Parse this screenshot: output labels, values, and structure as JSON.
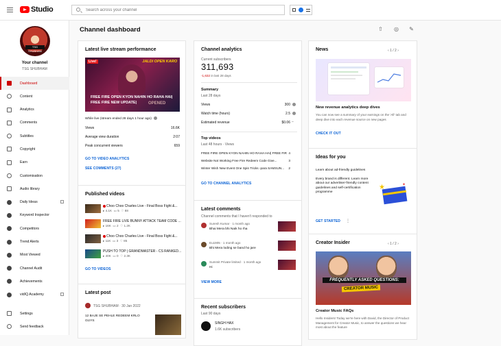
{
  "app": {
    "studio_label": "Studio",
    "search_placeholder": "Search across your channel"
  },
  "channel": {
    "label": "Your channel",
    "name": "TSG SHUBHAM",
    "avatar_text": "TSG SHUBHAM"
  },
  "nav": [
    {
      "label": "Dashboard",
      "icon": "dashboard-icon",
      "active": true
    },
    {
      "label": "Content",
      "icon": "content-icon"
    },
    {
      "label": "Analytics",
      "icon": "analytics-icon"
    },
    {
      "label": "Comments",
      "icon": "comments-icon"
    },
    {
      "label": "Subtitles",
      "icon": "subtitles-icon"
    },
    {
      "label": "Copyright",
      "icon": "copyright-icon"
    },
    {
      "label": "Earn",
      "icon": "earn-icon"
    },
    {
      "label": "Customisation",
      "icon": "customisation-icon"
    },
    {
      "label": "Audio library",
      "icon": "audio-library-icon"
    },
    {
      "label": "Daily Ideas",
      "icon": "daily-ideas-icon"
    },
    {
      "label": "Keyword Inspector",
      "icon": "keyword-inspector-icon"
    },
    {
      "label": "Competitors",
      "icon": "competitors-icon"
    },
    {
      "label": "Trend Alerts",
      "icon": "trend-alerts-icon"
    },
    {
      "label": "Most Viewed",
      "icon": "most-viewed-icon"
    },
    {
      "label": "Channel Audit",
      "icon": "channel-audit-icon"
    },
    {
      "label": "Achievements",
      "icon": "achievements-icon"
    },
    {
      "label": "vidIQ Academy",
      "icon": "vidiq-academy-icon"
    }
  ],
  "nav_bottom": [
    {
      "label": "Settings",
      "icon": "settings-icon"
    },
    {
      "label": "Send feedback",
      "icon": "feedback-icon"
    }
  ],
  "page": {
    "title": "Channel dashboard"
  },
  "live": {
    "title": "Latest live stream performance",
    "live_badge": "Live!",
    "thumb_top": "JALDI OPEN KARO",
    "thumb_text": "FREE FIRE OPEN KYON NAHIN HO RAHA HAI| FREE FIRE NEW UPDATE|",
    "thumb_overlay": "OPENED",
    "summary": "While live (stream ended 28 days 1 hour ago)",
    "stats": [
      {
        "label": "Views",
        "value": "16.6K"
      },
      {
        "label": "Average view duration",
        "value": "2:07"
      },
      {
        "label": "Peak concurrent viewers",
        "value": "659"
      }
    ],
    "link1": "GO TO VIDEO ANALYTICS",
    "link2": "SEE COMMENTS (27)"
  },
  "published": {
    "title": "Published videos",
    "items": [
      {
        "title": "Choo Choo Charles Live - Final Boss Fight &...",
        "views": "4.1K",
        "comments": "5",
        "likes": "88",
        "dot": true
      },
      {
        "title": "FREE FIRE LIVE BUNNY ATTACK TEAM CODE ...",
        "views": "16K",
        "comments": "2",
        "likes": "1.2K",
        "dot": false
      },
      {
        "title": "Choo Choo Charles Live - Final Boss Fight &...",
        "views": "11K",
        "comments": "3",
        "likes": "85",
        "dot": true
      },
      {
        "title": "PUSH TO TOP | GRANDMASTER - CS RANKED...",
        "views": "40K",
        "comments": "0",
        "likes": "2.3K",
        "dot": false
      }
    ],
    "link": "GO TO VIDEOS"
  },
  "latest_post": {
    "title": "Latest post",
    "author": "TSG SHUBHAM",
    "date": "30 Jan 2022",
    "text": "12 BAJE SE PEHLE REDEEM KRLO GUYS"
  },
  "analytics": {
    "title": "Channel analytics",
    "subs_label": "Current subscribers",
    "subs": "311,693",
    "change": "-1,632",
    "change_suffix": "in last 28 days",
    "summary_title": "Summary",
    "summary_range": "Last 28 days",
    "rows": [
      {
        "label": "Views",
        "value": "300"
      },
      {
        "label": "Watch time (hours)",
        "value": "2.5"
      },
      {
        "label": "Estimated revenue",
        "value": "$0.06"
      }
    ],
    "top_title": "Top videos",
    "top_range": "Last 48 hours · Views",
    "top_videos": [
      {
        "title": "FREE FIRE OPEN KYON NAHIN HO RAHA HAI| FREE FIR...",
        "value": "4"
      },
      {
        "title": "Website Not Working Free Fire Redeem Code Give...",
        "value": "3"
      },
      {
        "title": "Winter Wish New Event One Spin Tricks -para SAMSUN...",
        "value": "2"
      }
    ],
    "link": "GO TO CHANNEL ANALYTICS"
  },
  "comments": {
    "title": "Latest comments",
    "subtitle": "Channel comments that I haven't responded to",
    "items": [
      {
        "name": "Suresh Kumar · 1 month ago",
        "text": "Bhai Mera bhi Naik ho rha",
        "avatar": "#b03030"
      },
      {
        "name": "Eu1905 · 1 month ago",
        "text": "Bhi Mera loding se band ho jare",
        "avatar": "#6a4a2a"
      },
      {
        "name": "Summit Private limited · 1 month ago",
        "text": "Hi",
        "avatar": "#2a8a5a"
      }
    ],
    "link": "VIEW MORE"
  },
  "recent_subs": {
    "title": "Recent subscribers",
    "range": "Last 90 days",
    "name": "SINGH HAX",
    "count": "1.6K subscribers"
  },
  "news": {
    "title": "News",
    "pager": "1 / 2",
    "headline": "New revenue analytics deep dives",
    "text": "You can now see a summary of your earnings on the 'All' tab and deep dive into each revenue source on new pages",
    "link": "CHECK IT OUT"
  },
  "ideas": {
    "title": "Ideas for you",
    "subtitle": "Learn about ad-friendly guidelines",
    "text": "Every brand is different. Learn more about our advertiser-friendly content guidelines and self-certification programme",
    "link": "GET STARTED"
  },
  "creator": {
    "title": "Creator Insider",
    "pager": "1 / 2",
    "faq": "FREQUENTLY ASKED QUESTIONS:",
    "banner": "CREATOR MUSIC",
    "headline": "Creator Music FAQs",
    "text": "Hello Insiders! Today we're here with David, the Director of Product Management for Creator Music, to answer the questions we hear most about the feature"
  }
}
